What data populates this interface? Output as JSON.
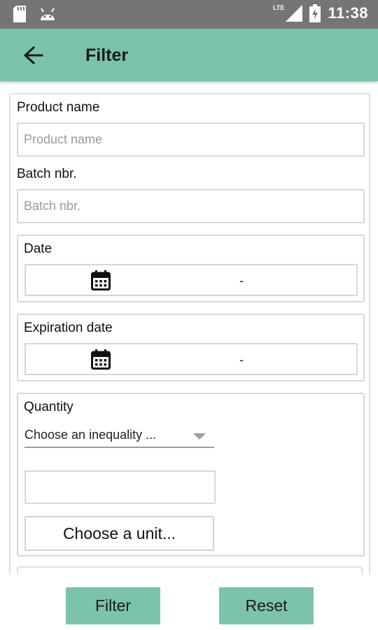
{
  "status_bar": {
    "time": "11:38",
    "network": "LTE",
    "icons": [
      "sd-card-icon",
      "android-icon",
      "signal-icon",
      "battery-charging-icon"
    ]
  },
  "app_bar": {
    "title": "Filter",
    "back_icon": "arrow-left-icon",
    "color": "#7cc3ad"
  },
  "form": {
    "product_name": {
      "label": "Product name",
      "placeholder": "Product name",
      "value": ""
    },
    "batch_nbr": {
      "label": "Batch nbr.",
      "placeholder": "Batch nbr.",
      "value": ""
    },
    "date": {
      "label": "Date",
      "range_separator": "-",
      "icon": "calendar-icon"
    },
    "expiration_date": {
      "label": "Expiration date",
      "range_separator": "-",
      "icon": "calendar-icon"
    },
    "quantity": {
      "label": "Quantity",
      "inequality_dropdown": "Choose an inequality ...",
      "value": "",
      "unit_button": "Choose a unit..."
    }
  },
  "actions": {
    "filter_label": "Filter",
    "reset_label": "Reset"
  }
}
